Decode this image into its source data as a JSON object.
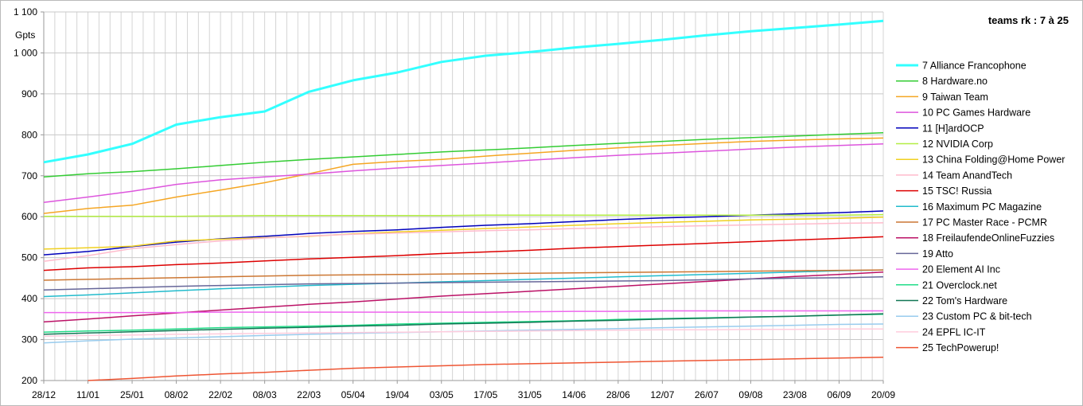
{
  "chart_data": {
    "type": "line",
    "title": "teams rk : 7 à 25",
    "ylabel": "Gpts",
    "xlabel": "",
    "ylim": [
      200,
      1100
    ],
    "yticks": [
      200,
      300,
      400,
      500,
      600,
      700,
      800,
      900,
      1000,
      1100
    ],
    "ytick_labels": [
      "200",
      "300",
      "400",
      "500",
      "600",
      "700",
      "800",
      "900",
      "1 000",
      "1 100"
    ],
    "xticks": [
      "28/12",
      "11/01",
      "25/01",
      "08/02",
      "22/02",
      "08/03",
      "22/03",
      "05/04",
      "19/04",
      "03/05",
      "17/05",
      "31/05",
      "14/06",
      "28/06",
      "12/07",
      "26/07",
      "09/08",
      "23/08",
      "06/09",
      "20/09"
    ],
    "x": [
      "28/12",
      "11/01",
      "25/01",
      "08/02",
      "22/02",
      "08/03",
      "22/03",
      "05/04",
      "19/04",
      "03/05",
      "17/05",
      "31/05",
      "14/06",
      "28/06",
      "12/07",
      "26/07",
      "09/08",
      "23/08",
      "06/09",
      "20/09"
    ],
    "grid": true,
    "legend_position": "right",
    "series": [
      {
        "name": "7 Alliance Francophone",
        "color": "#33ffff",
        "width": 3,
        "values": [
          733,
          752,
          778,
          825,
          843,
          857,
          905,
          933,
          952,
          978,
          993,
          1002,
          1013,
          1022,
          1032,
          1043,
          1053,
          1061,
          1069,
          1078
        ]
      },
      {
        "name": "8 Hardware.no",
        "color": "#33cc33",
        "width": 1.5,
        "values": [
          697,
          705,
          710,
          717,
          725,
          733,
          740,
          746,
          752,
          758,
          763,
          768,
          774,
          779,
          784,
          789,
          793,
          797,
          801,
          805
        ]
      },
      {
        "name": "9 Taiwan Team",
        "color": "#f5a623",
        "width": 1.5,
        "values": [
          608,
          620,
          628,
          648,
          665,
          683,
          705,
          728,
          735,
          740,
          748,
          755,
          762,
          768,
          774,
          779,
          784,
          787,
          790,
          792
        ]
      },
      {
        "name": "10 PC Games Hardware",
        "color": "#dd55dd",
        "width": 1.5,
        "values": [
          635,
          648,
          662,
          679,
          690,
          697,
          704,
          712,
          719,
          725,
          731,
          738,
          744,
          750,
          755,
          760,
          765,
          770,
          774,
          778
        ]
      },
      {
        "name": "11 [H]ardOCP",
        "color": "#0000bb",
        "width": 1.5,
        "values": [
          507,
          515,
          527,
          538,
          546,
          552,
          559,
          564,
          568,
          574,
          579,
          583,
          588,
          593,
          597,
          600,
          604,
          607,
          610,
          614
        ]
      },
      {
        "name": "12 NVIDIA Corp",
        "color": "#b3ee44",
        "width": 1.5,
        "values": [
          601,
          601,
          601,
          601,
          602,
          603,
          603,
          603,
          603,
          603,
          604,
          604,
          604,
          604,
          604,
          604,
          604,
          604,
          604,
          605
        ]
      },
      {
        "name": "13 China Folding@Home Power",
        "color": "#f0d020",
        "width": 1.5,
        "values": [
          521,
          524,
          528,
          541,
          545,
          549,
          552,
          558,
          563,
          567,
          571,
          575,
          579,
          583,
          586,
          589,
          592,
          594,
          596,
          599
        ]
      },
      {
        "name": "14 Team AnandTech",
        "color": "#ffbbcc",
        "width": 1.5,
        "values": [
          491,
          505,
          522,
          532,
          541,
          548,
          553,
          557,
          560,
          563,
          566,
          568,
          571,
          573,
          576,
          578,
          580,
          582,
          584,
          585
        ]
      },
      {
        "name": "15 TSC! Russia",
        "color": "#dd0000",
        "width": 1.5,
        "values": [
          469,
          475,
          478,
          483,
          487,
          492,
          497,
          501,
          505,
          510,
          514,
          518,
          523,
          527,
          531,
          535,
          539,
          543,
          547,
          551
        ]
      },
      {
        "name": "16 Maximum PC Magazine",
        "color": "#22bbcc",
        "width": 1.5,
        "values": [
          405,
          409,
          414,
          419,
          424,
          428,
          432,
          435,
          438,
          441,
          444,
          447,
          450,
          453,
          456,
          459,
          462,
          465,
          468,
          470
        ]
      },
      {
        "name": "17 PC Master Race - PCMR",
        "color": "#cc7733",
        "width": 1.5,
        "values": [
          445,
          447,
          449,
          451,
          453,
          455,
          457,
          458,
          459,
          460,
          461,
          462,
          463,
          464,
          465,
          466,
          467,
          468,
          469,
          470
        ]
      },
      {
        "name": "18 FreilaufendeOnlineFuzzies",
        "color": "#bb1166",
        "width": 1.5,
        "values": [
          343,
          350,
          358,
          365,
          372,
          379,
          386,
          392,
          399,
          406,
          412,
          418,
          424,
          430,
          436,
          442,
          448,
          454,
          459,
          465
        ]
      },
      {
        "name": "19 Atto",
        "color": "#666699",
        "width": 1.5,
        "values": [
          421,
          424,
          427,
          430,
          432,
          434,
          436,
          437,
          438,
          439,
          440,
          441,
          442,
          443,
          444,
          446,
          448,
          450,
          451,
          453
        ]
      },
      {
        "name": "20 Element AI Inc",
        "color": "#ee66ee",
        "width": 1.5,
        "values": [
          366,
          366,
          366,
          366,
          367,
          367,
          367,
          367,
          367,
          367,
          367,
          368,
          369,
          369,
          370,
          370,
          370,
          370,
          370,
          370
        ]
      },
      {
        "name": "21 Overclock.net",
        "color": "#22dd88",
        "width": 1.5,
        "values": [
          318,
          321,
          323,
          326,
          329,
          331,
          333,
          335,
          338,
          340,
          342,
          344,
          346,
          349,
          351,
          353,
          355,
          357,
          360,
          362
        ]
      },
      {
        "name": "22 Tom's Hardware",
        "color": "#117755",
        "width": 1.5,
        "values": [
          313,
          316,
          319,
          322,
          325,
          328,
          330,
          333,
          335,
          338,
          340,
          342,
          345,
          347,
          350,
          352,
          355,
          357,
          360,
          363
        ]
      },
      {
        "name": "23 Custom PC & bit-tech",
        "color": "#99ccee",
        "width": 1.5,
        "values": [
          292,
          297,
          301,
          304,
          307,
          310,
          313,
          315,
          317,
          319,
          321,
          323,
          325,
          327,
          329,
          331,
          333,
          335,
          337,
          338
        ]
      },
      {
        "name": "24 EPFL IC-IT",
        "color": "#ffccdd",
        "width": 1.5,
        "values": [
          308,
          310,
          311,
          313,
          314,
          315,
          316,
          317,
          318,
          319,
          320,
          321,
          322,
          323,
          324,
          324,
          325,
          325,
          326,
          326
        ]
      },
      {
        "name": "25 TechPowerup!",
        "color": "#ee5533",
        "width": 1.5,
        "values": [
          null,
          200,
          205,
          211,
          216,
          220,
          225,
          230,
          233,
          236,
          239,
          241,
          243,
          245,
          247,
          249,
          251,
          253,
          255,
          257
        ]
      }
    ]
  }
}
